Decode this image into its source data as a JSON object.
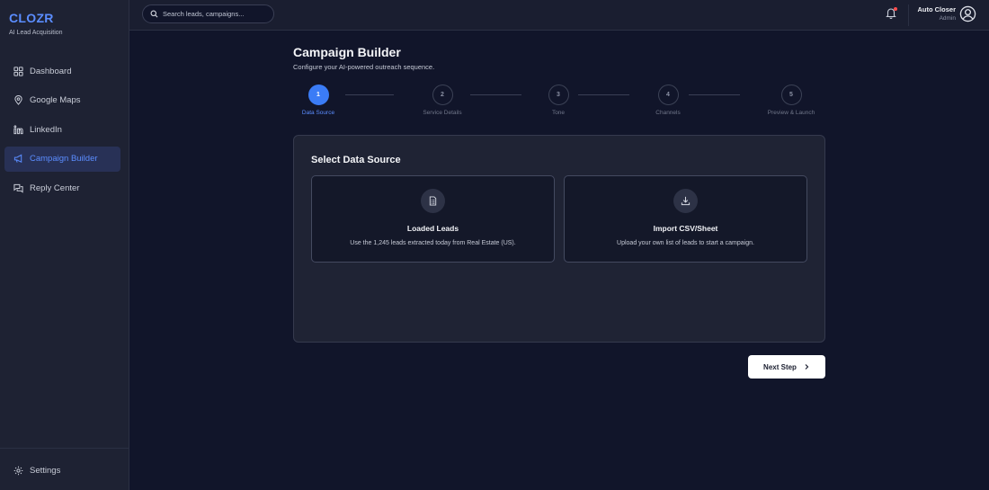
{
  "brand": {
    "name": "CLOZR",
    "subtitle": "AI Lead Acquisition"
  },
  "sidebar": {
    "items": [
      {
        "label": "Dashboard",
        "icon": "grid-icon",
        "active": false
      },
      {
        "label": "Google Maps",
        "icon": "map-pin-icon",
        "active": false
      },
      {
        "label": "LinkedIn",
        "icon": "linkedin-icon",
        "active": false
      },
      {
        "label": "Campaign Builder",
        "icon": "megaphone-icon",
        "active": true
      },
      {
        "label": "Reply Center",
        "icon": "chat-icon",
        "active": false
      }
    ],
    "footer": {
      "label": "Settings",
      "icon": "gear-icon"
    }
  },
  "search": {
    "placeholder": "Search leads, campaigns..."
  },
  "user": {
    "name": "Auto Closer",
    "role": "Admin"
  },
  "colors": {
    "accent": "#3b7cf6",
    "background": "#11152a",
    "sidebar": "#1e2233",
    "notification": "#ff4d4d"
  },
  "page": {
    "title": "Campaign Builder",
    "subtitle": "Configure your AI-powered outreach sequence."
  },
  "stepper": {
    "steps": [
      {
        "number": "1",
        "label": "Data Source",
        "active": true
      },
      {
        "number": "2",
        "label": "Service Details",
        "active": false
      },
      {
        "number": "3",
        "label": "Tone",
        "active": false
      },
      {
        "number": "4",
        "label": "Channels",
        "active": false
      },
      {
        "number": "5",
        "label": "Preview & Launch",
        "active": false
      }
    ]
  },
  "card": {
    "title": "Select Data Source",
    "options": [
      {
        "title": "Loaded Leads",
        "description": "Use the 1,245 leads extracted today from Real Estate (US).",
        "icon": "document-icon"
      },
      {
        "title": "Import CSV/Sheet",
        "description": "Upload your own list of leads to start a campaign.",
        "icon": "download-icon"
      }
    ]
  },
  "actions": {
    "next_label": "Next Step"
  }
}
